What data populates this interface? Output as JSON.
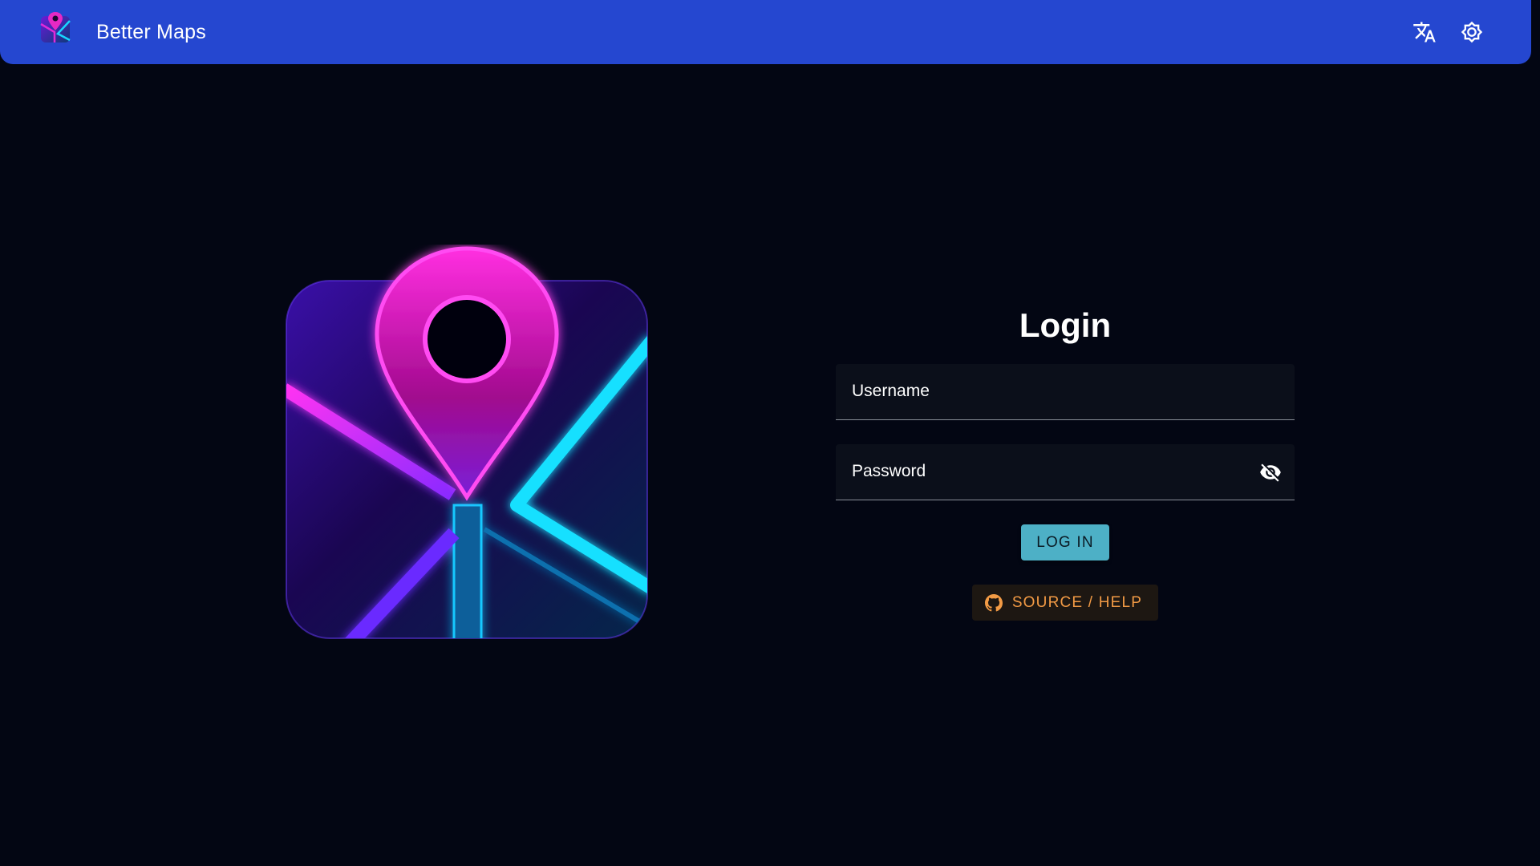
{
  "app_bar": {
    "title": "Better Maps",
    "logo_icon": "map-pin-logo-icon",
    "actions": [
      {
        "icon": "translate-icon",
        "label": "Language"
      },
      {
        "icon": "brightness-icon",
        "label": "Theme"
      }
    ],
    "color": "#2547d0"
  },
  "hero": {
    "icon": "neon-map-pin-illustration"
  },
  "login": {
    "title": "Login",
    "username": {
      "label": "Username",
      "value": ""
    },
    "password": {
      "label": "Password",
      "value": "",
      "toggle_icon": "eye-off-icon"
    },
    "submit_label": "LOG IN",
    "source_label": "SOURCE / HELP",
    "source_icon": "github-icon"
  },
  "colors": {
    "background": "#030613",
    "accent": "#4db0c6",
    "source_text": "#f39b45"
  }
}
